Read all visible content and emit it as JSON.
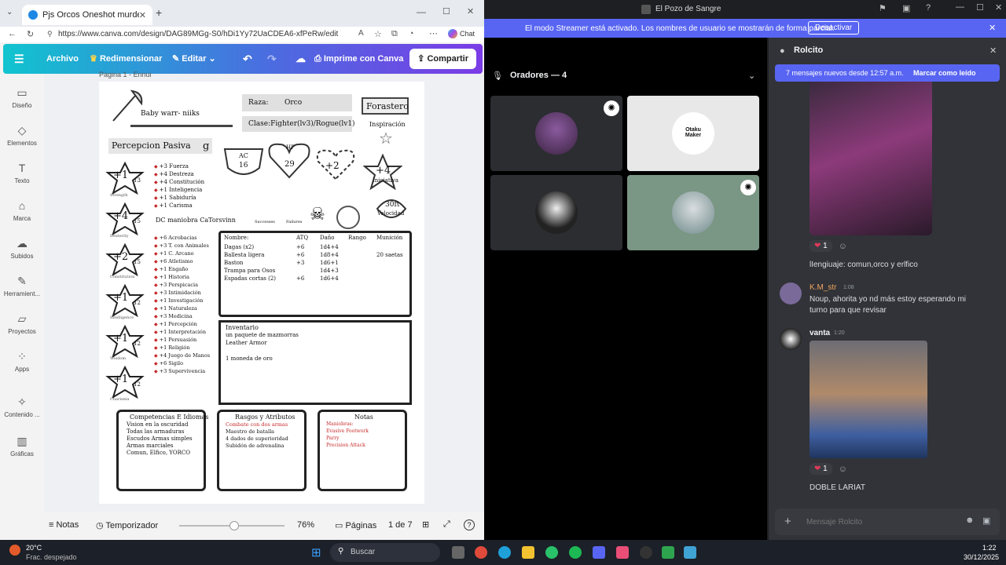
{
  "browser": {
    "tab_title": "Pjs Orcos Oneshot murder hobo -",
    "url": "https://www.canva.com/design/DAG89MGg-S0/hDi1Yy72UaCDEA6-xfPeRw/edit",
    "chat_label": "Chat"
  },
  "canva": {
    "menu": [
      "Archivo",
      "Redimensionar",
      "Editar"
    ],
    "print_label": "Imprime con Canva",
    "share_label": "Compartir",
    "page_label": "Página 1 - Ennui",
    "sidebar": [
      "Diseño",
      "Elementos",
      "Texto",
      "Marca",
      "Subidos",
      "Herramient...",
      "Proyectos",
      "Apps",
      "Contenido ...",
      "Gráficas"
    ],
    "bottom": {
      "notes": "Notas",
      "timer": "Temporizador",
      "zoom": "76%",
      "pages": "Páginas",
      "page_count": "1 de 7",
      "zoom_fraction": 0.52
    }
  },
  "sheet": {
    "name": "Baby warr- niiks",
    "race_label": "Raza:",
    "race": "Orco",
    "class": "Clase:Fighter(lv3)/Rogue(lv1)",
    "background": "Forastero",
    "inspiration": "Inspiración",
    "passive_perception": "Percepcion Pasiva",
    "passive_value": "g",
    "ac_label": "AC",
    "ac": "16",
    "hp_label": "HP",
    "hp": "29",
    "bonus": "+2",
    "initiative": "+4",
    "initiative_label": "Iniciativa",
    "speed": "30ft",
    "speed_label": "Velocidad",
    "dc": "DC maniobra CaTorsvinn",
    "successes": "Successes",
    "failures": "Failures",
    "abilities": [
      {
        "mod": "+1",
        "score": "13",
        "label": "Strength"
      },
      {
        "mod": "+4",
        "score": "15",
        "label": "Dexterity"
      },
      {
        "mod": "+2",
        "score": "15",
        "label": "Constitution"
      },
      {
        "mod": "+1",
        "score": "12",
        "label": "Intelligence"
      },
      {
        "mod": "+1",
        "score": "12",
        "label": "Wisdom"
      },
      {
        "mod": "+1",
        "score": "12",
        "label": "Charisma"
      }
    ],
    "saves": [
      "+3 Fuerza",
      "+4 Destreza",
      "+4 Constitución",
      "+1 Inteligencia",
      "+1 Sabiduría",
      "+1 Carisma"
    ],
    "skills": [
      "+6 Acrobacias",
      "+3 T. con Animales",
      "+1 C. Arcano",
      "+6 Atletismo",
      "+1 Engaño",
      "+1 Historia",
      "+3 Perspicacia",
      "+3 Intimidación",
      "+1 Investigación",
      "+1 Naturaleza",
      "+3 Medicina",
      "+1 Percepción",
      "+1 Interpretación",
      "+1 Persuasión",
      "+1 Religión",
      "+4 Juego de Manos",
      "+6 Sigilo",
      "+3 Supervivencia"
    ],
    "attack_headers": [
      "Nombre:",
      "ATQ",
      "Daño",
      "Rango",
      "Munición"
    ],
    "attacks": [
      [
        "Dagas (x2)",
        "+6",
        "1d4+4",
        "",
        ""
      ],
      [
        "Ballesta ligera",
        "+6",
        "1d8+4",
        "",
        "20 saetas"
      ],
      [
        "Baston",
        "+3",
        "1d6+1",
        "",
        ""
      ],
      [
        "Trampa para Osos",
        "",
        "1d4+3",
        "",
        ""
      ],
      [
        "Espadas cortas (2)",
        "+6",
        "1d6+4",
        "",
        ""
      ]
    ],
    "inventory_title": "Inventario",
    "inventory": [
      "un paquete de mazmorras",
      "Leather Armor",
      "",
      "1 moneda de oro"
    ],
    "competencias_title": "Competencias E Idiomas",
    "competencias": [
      "Vision en la oscuridad",
      "Todas las armaduras",
      "Escudos   Armas simples",
      "Armas marciales",
      "Comun, Elfico, YORCO"
    ],
    "rasgos_title": "Rasgos y Atributos",
    "rasgos": [
      "Combate con dos armas",
      "Maestro de batalla",
      "4 dados de superioridad",
      "Subidón de adrenalina"
    ],
    "notas_title": "Notas",
    "notas": [
      "Maniobras:",
      "Evasive Footwork",
      "Parry",
      "Precision Attack"
    ]
  },
  "discord": {
    "window_title": "El Pozo de Sangre",
    "streamer_text": "El modo Streamer está activado. Los nombres de usuario se mostrarán de forma parcial.",
    "deactivate": "Desactivar",
    "speakers": "Oradores — 4",
    "tile_label": "Otaku Maker",
    "channel": "Rolcito",
    "new_messages": "7 mensajes nuevos desde 12:57 a.m.",
    "mark_read": "Marcar como leído",
    "messages": [
      {
        "author": "",
        "time": "",
        "text": "lIengiuaje: comun,orco y erlfico",
        "reaction": "1"
      },
      {
        "author": "K.M_str",
        "time": "1:08",
        "text": "Noup, ahorita yo nd más estoy esperando mi turno para que revisar"
      },
      {
        "author": "vanta",
        "time": "1:20",
        "text": "DOBLE LARIAT",
        "reaction": "1"
      }
    ],
    "input_placeholder": "Mensaje Rolcito"
  },
  "taskbar": {
    "weather_temp": "20°C",
    "weather_desc": "Frac. despejado",
    "search": "Buscar",
    "time": "1:22",
    "date": "30/12/2025"
  },
  "colors": {
    "discord_blurple": "#5865f2",
    "discord_bg": "#313338",
    "author_orange": "#f0a45c"
  }
}
